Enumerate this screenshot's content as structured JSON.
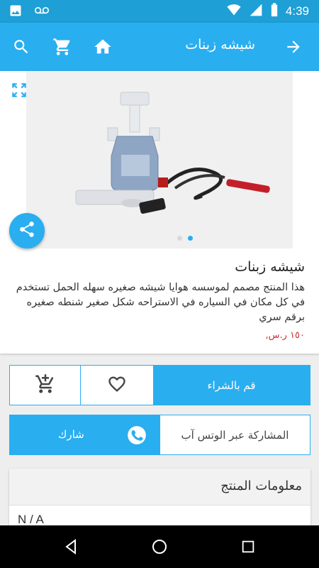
{
  "status_bar": {
    "time": "4:39",
    "icons": [
      "image-icon",
      "voicemail-icon",
      "wifi-icon",
      "signal-icon",
      "battery-icon"
    ]
  },
  "app_bar": {
    "title": "شيشه زبنات",
    "icons": [
      "search-icon",
      "cart-icon",
      "home-icon",
      "arrow-forward-icon"
    ]
  },
  "product": {
    "name": "شيشه زبنات",
    "description": "هذا المنتج مصمم لموسسه هوايا شيشه صغيره سهله الحمل تستخدم في كل مكان في السياره في الاستراحه شكل صغير شنطه صغيره برقم سري",
    "price": "١٥٠ ر.س,",
    "gallery": {
      "image_count": 2,
      "active_index": 1
    }
  },
  "actions": {
    "buy_label": "قم بالشراء",
    "favorite_icon": "heart-outline-icon",
    "add_cart_icon": "cart-plus-icon"
  },
  "share": {
    "whatsapp_text": "المشاركة عبر الوتس آب",
    "share_label": "شارك"
  },
  "info": {
    "title": "معلومات المنتج",
    "value": "N / A"
  },
  "colors": {
    "primary": "#29aef0",
    "status_bar": "#1e9fd6",
    "price": "#d32f2f"
  }
}
